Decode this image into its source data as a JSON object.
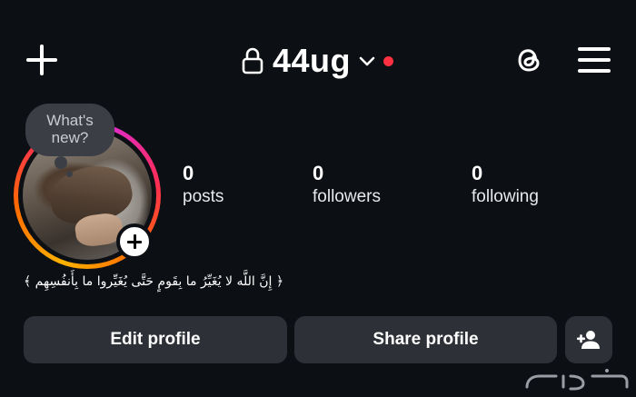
{
  "header": {
    "username": "44ug",
    "icons": {
      "create": "plus-icon",
      "lock": "lock-icon",
      "switch": "chevron-down-icon",
      "threads": "threads-icon",
      "menu": "hamburger-menu-icon"
    },
    "notification_dot_color": "#ff3040"
  },
  "profile": {
    "note_placeholder": "What's new?",
    "bio": "﴿ إِنَّ اللَّه لا يُغَيِّرُ ما بِقَومٍ حَتَّى يُغَيِّروا ما بِأَنفُسِهِم ﴾",
    "stats": [
      {
        "value": "0",
        "label": "posts"
      },
      {
        "value": "0",
        "label": "followers"
      },
      {
        "value": "0",
        "label": "following"
      }
    ]
  },
  "actions": {
    "edit_profile": "Edit profile",
    "share_profile": "Share profile",
    "suggested_icon": "add-person-icon"
  },
  "watermark": "حراج",
  "colors": {
    "background": "#0c0f14",
    "button_bg": "#2d3137",
    "story_ring_start": "#ffb200",
    "story_ring_end": "#e12cc6"
  }
}
